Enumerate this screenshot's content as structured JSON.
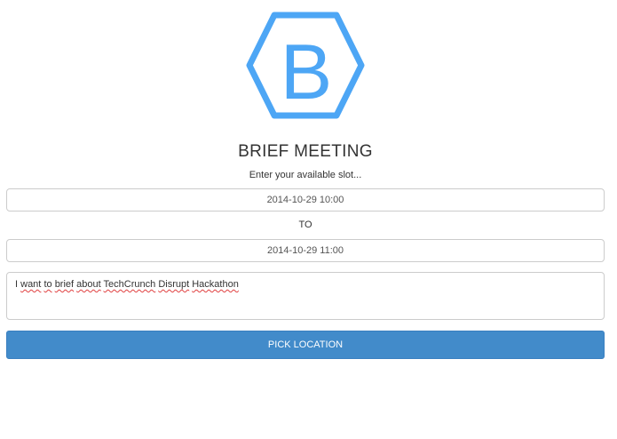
{
  "logo": {
    "letter": "B",
    "icon": "hexagon-b-logo-icon",
    "color": "#4da6f5"
  },
  "header": {
    "title": "BRIEF MEETING",
    "subtitle": "Enter your available slot..."
  },
  "form": {
    "start_value": "2014-10-29 10:00",
    "to_label": "TO",
    "end_value": "2014-10-29 11:00",
    "message_words": [
      "I",
      "want",
      "to",
      "brief",
      "about",
      "TechCrunch",
      "Disrupt",
      "Hackathon"
    ]
  },
  "actions": {
    "pick_location_label": "PICK LOCATION",
    "button_color": "#428bca"
  }
}
